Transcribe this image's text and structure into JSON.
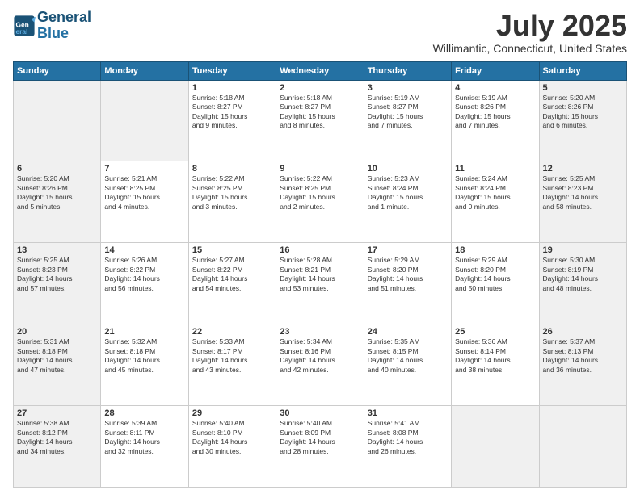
{
  "header": {
    "logo_line1": "General",
    "logo_line2": "Blue",
    "month": "July 2025",
    "location": "Willimantic, Connecticut, United States"
  },
  "weekdays": [
    "Sunday",
    "Monday",
    "Tuesday",
    "Wednesday",
    "Thursday",
    "Friday",
    "Saturday"
  ],
  "weeks": [
    [
      {
        "day": "",
        "info": ""
      },
      {
        "day": "",
        "info": ""
      },
      {
        "day": "1",
        "info": "Sunrise: 5:18 AM\nSunset: 8:27 PM\nDaylight: 15 hours\nand 9 minutes."
      },
      {
        "day": "2",
        "info": "Sunrise: 5:18 AM\nSunset: 8:27 PM\nDaylight: 15 hours\nand 8 minutes."
      },
      {
        "day": "3",
        "info": "Sunrise: 5:19 AM\nSunset: 8:27 PM\nDaylight: 15 hours\nand 7 minutes."
      },
      {
        "day": "4",
        "info": "Sunrise: 5:19 AM\nSunset: 8:26 PM\nDaylight: 15 hours\nand 7 minutes."
      },
      {
        "day": "5",
        "info": "Sunrise: 5:20 AM\nSunset: 8:26 PM\nDaylight: 15 hours\nand 6 minutes."
      }
    ],
    [
      {
        "day": "6",
        "info": "Sunrise: 5:20 AM\nSunset: 8:26 PM\nDaylight: 15 hours\nand 5 minutes."
      },
      {
        "day": "7",
        "info": "Sunrise: 5:21 AM\nSunset: 8:25 PM\nDaylight: 15 hours\nand 4 minutes."
      },
      {
        "day": "8",
        "info": "Sunrise: 5:22 AM\nSunset: 8:25 PM\nDaylight: 15 hours\nand 3 minutes."
      },
      {
        "day": "9",
        "info": "Sunrise: 5:22 AM\nSunset: 8:25 PM\nDaylight: 15 hours\nand 2 minutes."
      },
      {
        "day": "10",
        "info": "Sunrise: 5:23 AM\nSunset: 8:24 PM\nDaylight: 15 hours\nand 1 minute."
      },
      {
        "day": "11",
        "info": "Sunrise: 5:24 AM\nSunset: 8:24 PM\nDaylight: 15 hours\nand 0 minutes."
      },
      {
        "day": "12",
        "info": "Sunrise: 5:25 AM\nSunset: 8:23 PM\nDaylight: 14 hours\nand 58 minutes."
      }
    ],
    [
      {
        "day": "13",
        "info": "Sunrise: 5:25 AM\nSunset: 8:23 PM\nDaylight: 14 hours\nand 57 minutes."
      },
      {
        "day": "14",
        "info": "Sunrise: 5:26 AM\nSunset: 8:22 PM\nDaylight: 14 hours\nand 56 minutes."
      },
      {
        "day": "15",
        "info": "Sunrise: 5:27 AM\nSunset: 8:22 PM\nDaylight: 14 hours\nand 54 minutes."
      },
      {
        "day": "16",
        "info": "Sunrise: 5:28 AM\nSunset: 8:21 PM\nDaylight: 14 hours\nand 53 minutes."
      },
      {
        "day": "17",
        "info": "Sunrise: 5:29 AM\nSunset: 8:20 PM\nDaylight: 14 hours\nand 51 minutes."
      },
      {
        "day": "18",
        "info": "Sunrise: 5:29 AM\nSunset: 8:20 PM\nDaylight: 14 hours\nand 50 minutes."
      },
      {
        "day": "19",
        "info": "Sunrise: 5:30 AM\nSunset: 8:19 PM\nDaylight: 14 hours\nand 48 minutes."
      }
    ],
    [
      {
        "day": "20",
        "info": "Sunrise: 5:31 AM\nSunset: 8:18 PM\nDaylight: 14 hours\nand 47 minutes."
      },
      {
        "day": "21",
        "info": "Sunrise: 5:32 AM\nSunset: 8:18 PM\nDaylight: 14 hours\nand 45 minutes."
      },
      {
        "day": "22",
        "info": "Sunrise: 5:33 AM\nSunset: 8:17 PM\nDaylight: 14 hours\nand 43 minutes."
      },
      {
        "day": "23",
        "info": "Sunrise: 5:34 AM\nSunset: 8:16 PM\nDaylight: 14 hours\nand 42 minutes."
      },
      {
        "day": "24",
        "info": "Sunrise: 5:35 AM\nSunset: 8:15 PM\nDaylight: 14 hours\nand 40 minutes."
      },
      {
        "day": "25",
        "info": "Sunrise: 5:36 AM\nSunset: 8:14 PM\nDaylight: 14 hours\nand 38 minutes."
      },
      {
        "day": "26",
        "info": "Sunrise: 5:37 AM\nSunset: 8:13 PM\nDaylight: 14 hours\nand 36 minutes."
      }
    ],
    [
      {
        "day": "27",
        "info": "Sunrise: 5:38 AM\nSunset: 8:12 PM\nDaylight: 14 hours\nand 34 minutes."
      },
      {
        "day": "28",
        "info": "Sunrise: 5:39 AM\nSunset: 8:11 PM\nDaylight: 14 hours\nand 32 minutes."
      },
      {
        "day": "29",
        "info": "Sunrise: 5:40 AM\nSunset: 8:10 PM\nDaylight: 14 hours\nand 30 minutes."
      },
      {
        "day": "30",
        "info": "Sunrise: 5:40 AM\nSunset: 8:09 PM\nDaylight: 14 hours\nand 28 minutes."
      },
      {
        "day": "31",
        "info": "Sunrise: 5:41 AM\nSunset: 8:08 PM\nDaylight: 14 hours\nand 26 minutes."
      },
      {
        "day": "",
        "info": ""
      },
      {
        "day": "",
        "info": ""
      }
    ]
  ]
}
